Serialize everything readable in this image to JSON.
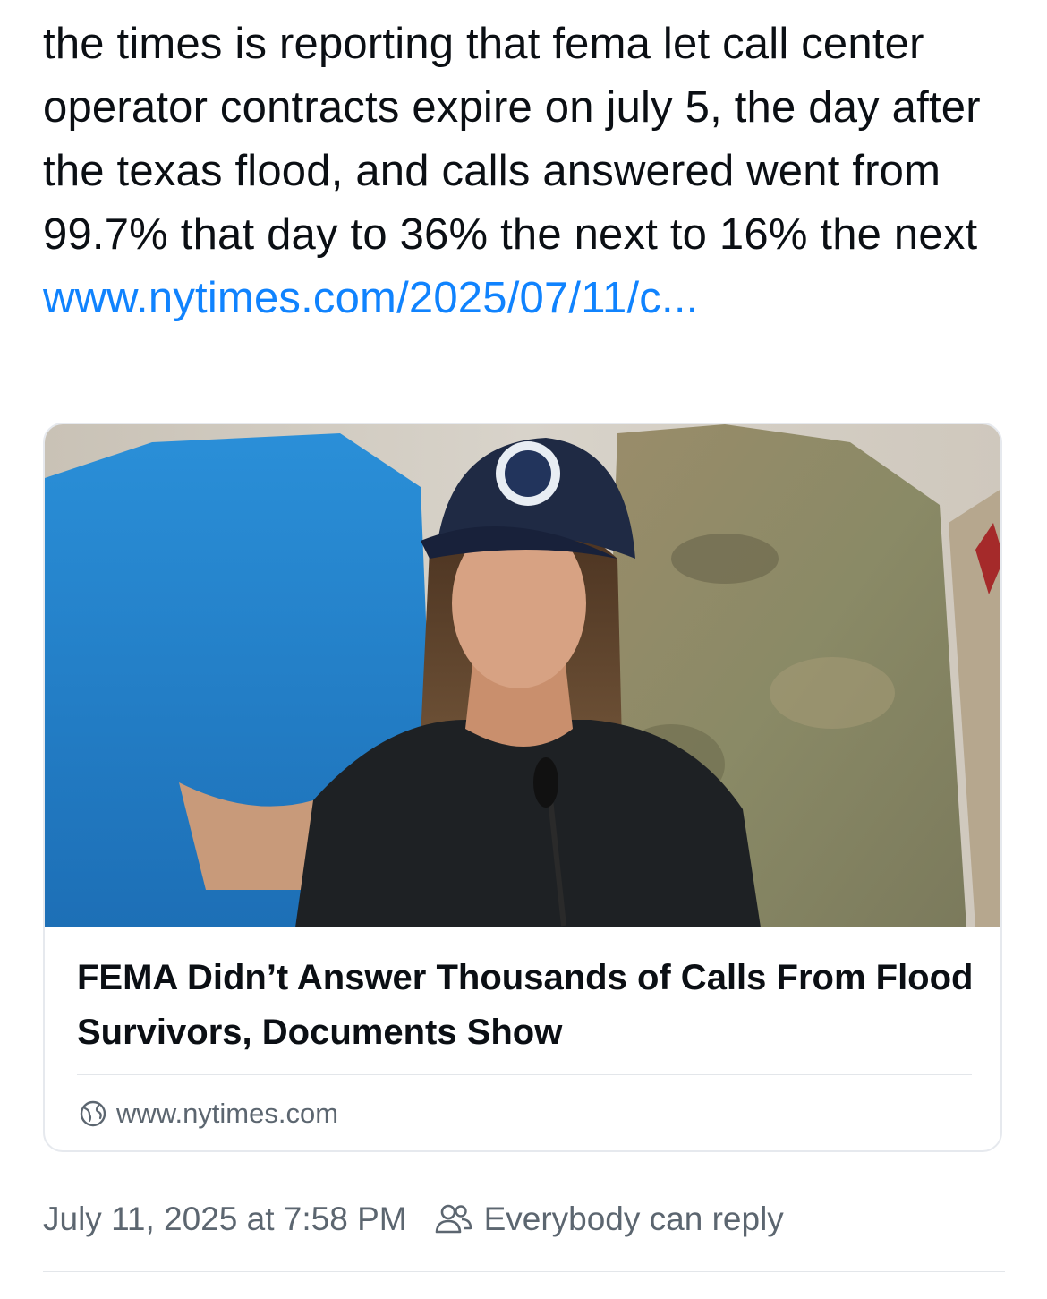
{
  "post": {
    "text": "the times is reporting that fema let call center operator contracts expire on july 5, the day after the texas flood, and calls answered went from 99.7% that day to 36% the next to 16% the next",
    "link_text": "www.nytimes.com/2025/07/11/c..."
  },
  "link_card": {
    "image_icon": "news-photo",
    "headline": "FEMA Didn’t Answer Thousands of Calls From Flood Survivors, Documents Show",
    "domain": "www.nytimes.com",
    "domain_icon": "globe-icon"
  },
  "meta": {
    "timestamp": "July 11, 2025 at 7:58 PM",
    "reply_setting": "Everybody can reply",
    "reply_icon": "people-icon"
  },
  "colors": {
    "text": "#0b0f14",
    "link": "#1083fe",
    "secondary": "#5c6670",
    "border": "#e6e9ee"
  }
}
